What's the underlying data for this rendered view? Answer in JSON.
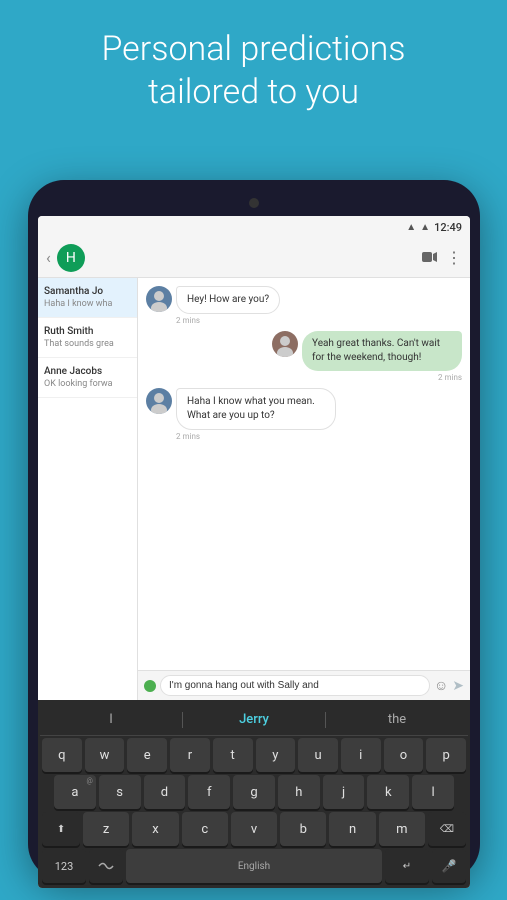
{
  "header": {
    "line1": "Personal predictions",
    "line2": "tailored to you"
  },
  "statusBar": {
    "time": "12:49",
    "wifi": "▲"
  },
  "appBar": {
    "backLabel": "‹",
    "videoLabel": "▶",
    "moreLabel": "⋮"
  },
  "sidebar": {
    "items": [
      {
        "name": "Samantha Jo",
        "preview": "Haha I know wha",
        "active": true
      },
      {
        "name": "Ruth Smith",
        "preview": "That sounds grea"
      },
      {
        "name": "Anne Jacobs",
        "preview": "OK looking forwa"
      }
    ]
  },
  "messages": [
    {
      "id": 1,
      "type": "incoming",
      "text": "Hey! How are you?",
      "time": "2 mins"
    },
    {
      "id": 2,
      "type": "outgoing",
      "text": "Yeah great thanks. Can't wait for the weekend, though!",
      "time": "2 mins"
    },
    {
      "id": 3,
      "type": "incoming",
      "text": "Haha I know what you mean. What are you up to?",
      "time": "2 mins"
    }
  ],
  "inputBar": {
    "placeholder": "I'm gonna hang out with Sally and",
    "value": "I'm gonna hang out with Sally and"
  },
  "keyboard": {
    "predictions": [
      {
        "label": "I",
        "highlight": false
      },
      {
        "label": "Jerry",
        "highlight": true
      },
      {
        "label": "the",
        "highlight": false
      }
    ],
    "rows": [
      [
        "q",
        "w",
        "e",
        "r",
        "t",
        "y",
        "u",
        "i",
        "o",
        "p"
      ],
      [
        "a",
        "s",
        "d",
        "f",
        "g",
        "h",
        "j",
        "k",
        "l"
      ],
      [
        "z",
        "x",
        "c",
        "v",
        "b",
        "n",
        "m"
      ]
    ],
    "rowSubs": [
      [
        "",
        "",
        "",
        "",
        "",
        "",
        "",
        "",
        "",
        ""
      ],
      [
        "@",
        "£",
        "",
        "",
        "",
        "",
        "",
        "",
        ""
      ],
      [
        "",
        "",
        "",
        "",
        "",
        "",
        ""
      ]
    ],
    "specialKeys": {
      "shift": "⬆",
      "backspace": "⌫",
      "numbers": "123",
      "swipe": "~",
      "space": "English",
      "enter": "↵",
      "emoji": "☺"
    }
  }
}
